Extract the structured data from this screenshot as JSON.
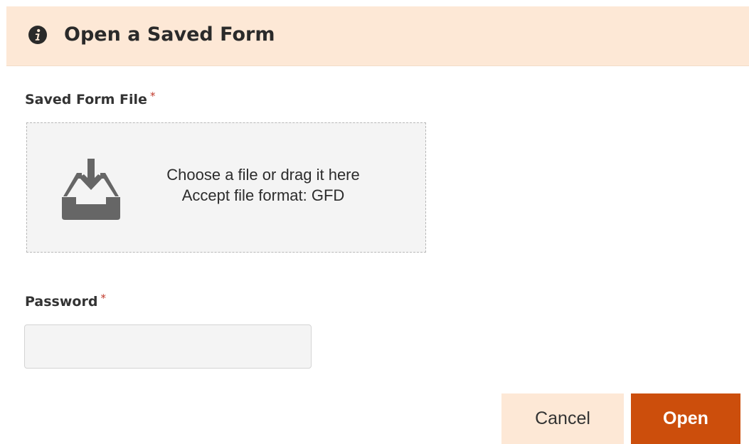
{
  "dialog": {
    "title": "Open a Saved Form",
    "header_icon": "info-circle-icon",
    "header_bg": "#fde8d6"
  },
  "file_field": {
    "label": "Saved Form File",
    "required_mark": "*",
    "upload_icon": "tray-download-icon",
    "prompt": "Choose a file or drag it here",
    "format_note": "Accept file format: GFD"
  },
  "password_field": {
    "label": "Password",
    "required_mark": "*",
    "value": "",
    "placeholder": ""
  },
  "actions": {
    "cancel_label": "Cancel",
    "open_label": "Open",
    "accent_color": "#cc4e0c"
  }
}
